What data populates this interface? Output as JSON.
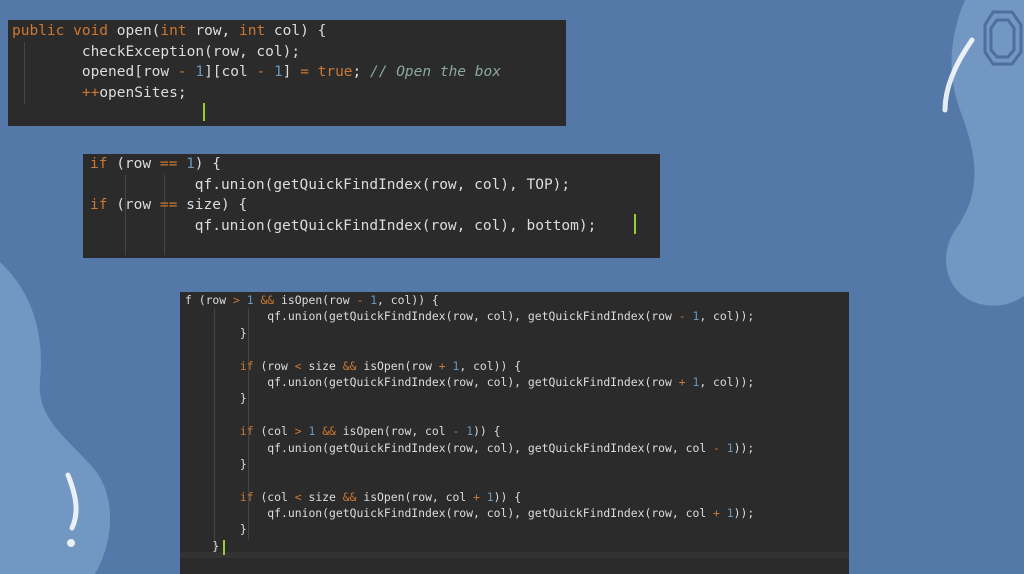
{
  "snippet_open": {
    "lines": [
      [
        {
          "t": "public void ",
          "c": "kw"
        },
        {
          "t": "open(",
          "c": "txt"
        },
        {
          "t": "int ",
          "c": "kw"
        },
        {
          "t": "row, ",
          "c": "txt"
        },
        {
          "t": "int ",
          "c": "kw"
        },
        {
          "t": "col) {",
          "c": "txt"
        }
      ],
      [
        {
          "t": "        checkException(row, col);",
          "c": "txt"
        }
      ],
      [
        {
          "t": "        opened[row ",
          "c": "txt"
        },
        {
          "t": "- ",
          "c": "op"
        },
        {
          "t": "1",
          "c": "num"
        },
        {
          "t": "][col ",
          "c": "txt"
        },
        {
          "t": "- ",
          "c": "op"
        },
        {
          "t": "1",
          "c": "num"
        },
        {
          "t": "] ",
          "c": "txt"
        },
        {
          "t": "= ",
          "c": "op"
        },
        {
          "t": "true",
          "c": "kw"
        },
        {
          "t": "; ",
          "c": "txt"
        },
        {
          "t": "// Open the box",
          "c": "cm"
        }
      ],
      [
        {
          "t": "        ",
          "c": "txt"
        },
        {
          "t": "++",
          "c": "op"
        },
        {
          "t": "openSites;",
          "c": "txt"
        }
      ]
    ]
  },
  "snippet_top_bottom": {
    "lines": [
      [
        {
          "t": "if ",
          "c": "kw"
        },
        {
          "t": "(row ",
          "c": "txt"
        },
        {
          "t": "== ",
          "c": "op"
        },
        {
          "t": "1",
          "c": "num"
        },
        {
          "t": ") {",
          "c": "txt"
        }
      ],
      [
        {
          "t": "            qf.union(getQuickFindIndex(row, col), TOP);",
          "c": "txt"
        }
      ],
      [
        {
          "t": "if ",
          "c": "kw"
        },
        {
          "t": "(row ",
          "c": "txt"
        },
        {
          "t": "== ",
          "c": "op"
        },
        {
          "t": "size) {",
          "c": "txt"
        }
      ],
      [
        {
          "t": "            qf.union(getQuickFindIndex(row, col), bottom);",
          "c": "txt"
        }
      ]
    ]
  },
  "snippet_neighbors": {
    "lines": [
      [
        {
          "t": "f (row ",
          "c": "txt"
        },
        {
          "t": "> ",
          "c": "op"
        },
        {
          "t": "1 ",
          "c": "num"
        },
        {
          "t": "&& ",
          "c": "op"
        },
        {
          "t": "isOpen(row ",
          "c": "txt"
        },
        {
          "t": "- ",
          "c": "op"
        },
        {
          "t": "1",
          "c": "num"
        },
        {
          "t": ", col)) {",
          "c": "txt"
        }
      ],
      [
        {
          "t": "            qf.union(getQuickFindIndex(row, col), getQuickFindIndex(row ",
          "c": "txt"
        },
        {
          "t": "- ",
          "c": "op"
        },
        {
          "t": "1",
          "c": "num"
        },
        {
          "t": ", col));",
          "c": "txt"
        }
      ],
      [
        {
          "t": "        }",
          "c": "txt"
        }
      ],
      [
        {
          "t": "",
          "c": "txt"
        }
      ],
      [
        {
          "t": "        ",
          "c": "txt"
        },
        {
          "t": "if ",
          "c": "kw"
        },
        {
          "t": "(row ",
          "c": "txt"
        },
        {
          "t": "< ",
          "c": "op"
        },
        {
          "t": "size ",
          "c": "txt"
        },
        {
          "t": "&& ",
          "c": "op"
        },
        {
          "t": "isOpen(row ",
          "c": "txt"
        },
        {
          "t": "+ ",
          "c": "op"
        },
        {
          "t": "1",
          "c": "num"
        },
        {
          "t": ", col)) {",
          "c": "txt"
        }
      ],
      [
        {
          "t": "            qf.union(getQuickFindIndex(row, col), getQuickFindIndex(row ",
          "c": "txt"
        },
        {
          "t": "+ ",
          "c": "op"
        },
        {
          "t": "1",
          "c": "num"
        },
        {
          "t": ", col));",
          "c": "txt"
        }
      ],
      [
        {
          "t": "        }",
          "c": "txt"
        }
      ],
      [
        {
          "t": "",
          "c": "txt"
        }
      ],
      [
        {
          "t": "        ",
          "c": "txt"
        },
        {
          "t": "if ",
          "c": "kw"
        },
        {
          "t": "(col ",
          "c": "txt"
        },
        {
          "t": "> ",
          "c": "op"
        },
        {
          "t": "1 ",
          "c": "num"
        },
        {
          "t": "&& ",
          "c": "op"
        },
        {
          "t": "isOpen(row, col ",
          "c": "txt"
        },
        {
          "t": "- ",
          "c": "op"
        },
        {
          "t": "1",
          "c": "num"
        },
        {
          "t": ")) {",
          "c": "txt"
        }
      ],
      [
        {
          "t": "            qf.union(getQuickFindIndex(row, col), getQuickFindIndex(row, col ",
          "c": "txt"
        },
        {
          "t": "- ",
          "c": "op"
        },
        {
          "t": "1",
          "c": "num"
        },
        {
          "t": "));",
          "c": "txt"
        }
      ],
      [
        {
          "t": "        }",
          "c": "txt"
        }
      ],
      [
        {
          "t": "",
          "c": "txt"
        }
      ],
      [
        {
          "t": "        ",
          "c": "txt"
        },
        {
          "t": "if ",
          "c": "kw"
        },
        {
          "t": "(col ",
          "c": "txt"
        },
        {
          "t": "< ",
          "c": "op"
        },
        {
          "t": "size ",
          "c": "txt"
        },
        {
          "t": "&& ",
          "c": "op"
        },
        {
          "t": "isOpen(row, col ",
          "c": "txt"
        },
        {
          "t": "+ ",
          "c": "op"
        },
        {
          "t": "1",
          "c": "num"
        },
        {
          "t": ")) {",
          "c": "txt"
        }
      ],
      [
        {
          "t": "            qf.union(getQuickFindIndex(row, col), getQuickFindIndex(row, col ",
          "c": "txt"
        },
        {
          "t": "+ ",
          "c": "op"
        },
        {
          "t": "1",
          "c": "num"
        },
        {
          "t": "));",
          "c": "txt"
        }
      ],
      [
        {
          "t": "        }",
          "c": "txt"
        }
      ],
      [
        {
          "t": "    }",
          "c": "txt"
        }
      ]
    ]
  },
  "colors": {
    "background": "#5479a8",
    "blob": "#7197c2",
    "editor_bg": "#2b2b2b",
    "keyword": "#cc7832",
    "number": "#6897bb",
    "comment": "#8aa8a0",
    "text": "#dcdcdc",
    "cursor": "#9acd32"
  },
  "icons": [
    "gem-outline-icon"
  ]
}
